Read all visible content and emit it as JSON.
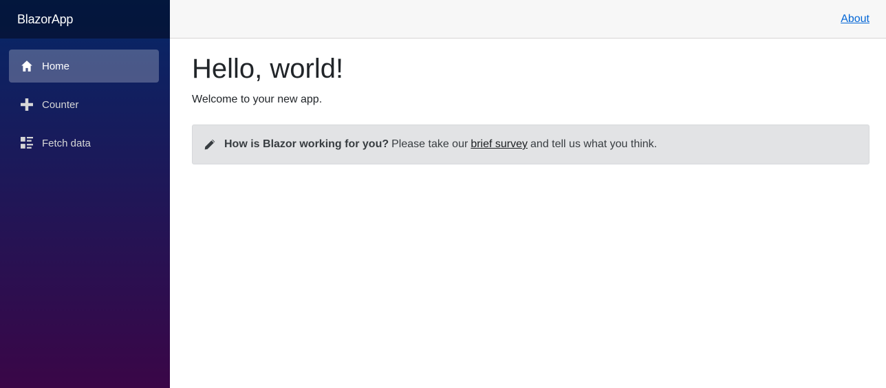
{
  "brand": {
    "title": "BlazorApp"
  },
  "nav": {
    "items": [
      {
        "label": "Home",
        "icon": "home-icon",
        "active": true
      },
      {
        "label": "Counter",
        "icon": "plus-icon",
        "active": false
      },
      {
        "label": "Fetch data",
        "icon": "list-rich-icon",
        "active": false
      }
    ]
  },
  "top_row": {
    "about_label": "About"
  },
  "page": {
    "title": "Hello, world!",
    "welcome": "Welcome to your new app.",
    "survey": {
      "icon": "pencil-icon",
      "question": "How is Blazor working for you?",
      "prefix": "Please take our",
      "link_text": "brief survey",
      "suffix": "and tell us what you think."
    }
  },
  "colors": {
    "sidebar_top": "#052767",
    "sidebar_bottom": "#3a0647",
    "link": "#0366d6",
    "alert_bg": "#e2e3e5"
  }
}
